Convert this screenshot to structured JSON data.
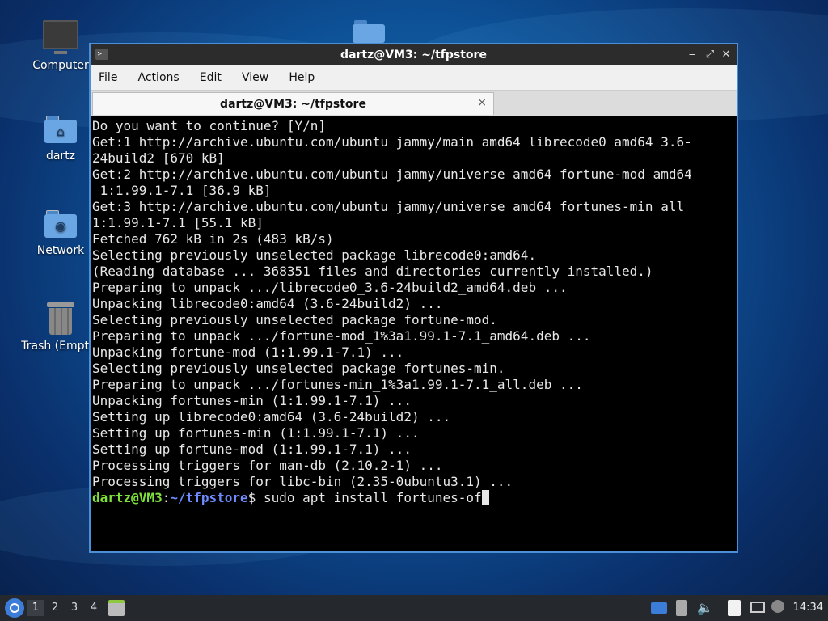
{
  "desktop": {
    "icons": [
      {
        "label": "Computer",
        "icon": "computer-icon"
      },
      {
        "label": "dartz",
        "icon": "home-folder-icon"
      },
      {
        "label": "Network",
        "icon": "network-folder-icon"
      },
      {
        "label": "Trash (Empty)",
        "icon": "trash-icon"
      }
    ]
  },
  "window": {
    "title": "dartz@VM3: ~/tfpstore",
    "menu": [
      "File",
      "Actions",
      "Edit",
      "View",
      "Help"
    ],
    "tab": {
      "label": "dartz@VM3: ~/tfpstore",
      "close": "×"
    },
    "controls": {
      "minimize": "‒",
      "maximize": "⤢",
      "close": "✕"
    }
  },
  "terminal": {
    "lines": [
      "Do you want to continue? [Y/n]",
      "Get:1 http://archive.ubuntu.com/ubuntu jammy/main amd64 librecode0 amd64 3.6-",
      "24build2 [670 kB]",
      "Get:2 http://archive.ubuntu.com/ubuntu jammy/universe amd64 fortune-mod amd64",
      " 1:1.99.1-7.1 [36.9 kB]",
      "Get:3 http://archive.ubuntu.com/ubuntu jammy/universe amd64 fortunes-min all",
      "1:1.99.1-7.1 [55.1 kB]",
      "Fetched 762 kB in 2s (483 kB/s)",
      "Selecting previously unselected package librecode0:amd64.",
      "(Reading database ... 368351 files and directories currently installed.)",
      "Preparing to unpack .../librecode0_3.6-24build2_amd64.deb ...",
      "Unpacking librecode0:amd64 (3.6-24build2) ...",
      "Selecting previously unselected package fortune-mod.",
      "Preparing to unpack .../fortune-mod_1%3a1.99.1-7.1_amd64.deb ...",
      "Unpacking fortune-mod (1:1.99.1-7.1) ...",
      "Selecting previously unselected package fortunes-min.",
      "Preparing to unpack .../fortunes-min_1%3a1.99.1-7.1_all.deb ...",
      "Unpacking fortunes-min (1:1.99.1-7.1) ...",
      "Setting up librecode0:amd64 (3.6-24build2) ...",
      "Setting up fortunes-min (1:1.99.1-7.1) ...",
      "Setting up fortune-mod (1:1.99.1-7.1) ...",
      "Processing triggers for man-db (2.10.2-1) ...",
      "Processing triggers for libc-bin (2.35-0ubuntu3.1) ..."
    ],
    "prompt": {
      "user": "dartz@VM3",
      "sep": ":",
      "path": "~/tfpstore",
      "symbol": "$",
      "command": " sudo apt install fortunes-of"
    }
  },
  "taskbar": {
    "workspaces": [
      "1",
      "2",
      "3",
      "4"
    ],
    "active_workspace": "1",
    "clock": "14:34",
    "tray_icons": [
      "display-icon",
      "clipboard-icon",
      "volume-icon",
      "notes-icon",
      "network-icon",
      "updates-icon"
    ]
  }
}
